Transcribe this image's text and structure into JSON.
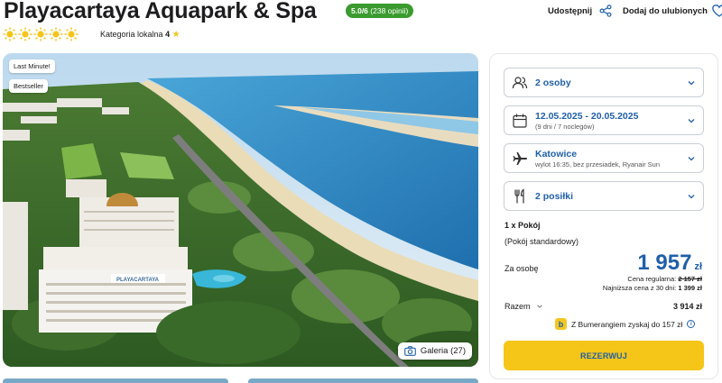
{
  "hotel": {
    "name": "Playacartaya Aquapark & Spa",
    "rating": "5.0/6",
    "reviews": "(238 opinii)",
    "category_label": "Kategoria lokalna",
    "category_value": "4",
    "suns": 5
  },
  "actions": {
    "share": "Udostępnij",
    "favorite": "Dodaj do ulubionych"
  },
  "photo": {
    "badges": [
      "Last Minute!",
      "Bestseller"
    ],
    "gallery_label": "Galeria (27)"
  },
  "booking": {
    "persons": "2 osoby",
    "dates": "12.05.2025 - 20.05.2025",
    "dates_sub": "(9 dni / 7 noclegów)",
    "departure": "Katowice",
    "departure_sub": "wylot 16:35, bez przesiadek, Ryanair Sun",
    "meals": "2 posiłki",
    "room_count": "1 x Pokój",
    "room_type": "(Pokój standardowy)",
    "per_person_label": "Za osobę",
    "price": "1 957",
    "currency": "zł",
    "regular_label": "Cena regularna:",
    "regular_price": "2 157 zł",
    "lowest_label": "Najniższa cena z 30 dni:",
    "lowest_price": "1 399 zł",
    "total_label": "Razem",
    "total_value": "3 914 zł",
    "bumerang_text": "Z Bumerangiem zyskaj do 157 zł",
    "reserve_button": "REZERWUJ"
  },
  "colors": {
    "brand_blue": "#1f5fa8",
    "accent_yellow": "#f5c518",
    "rating_green": "#3a9b2e"
  }
}
